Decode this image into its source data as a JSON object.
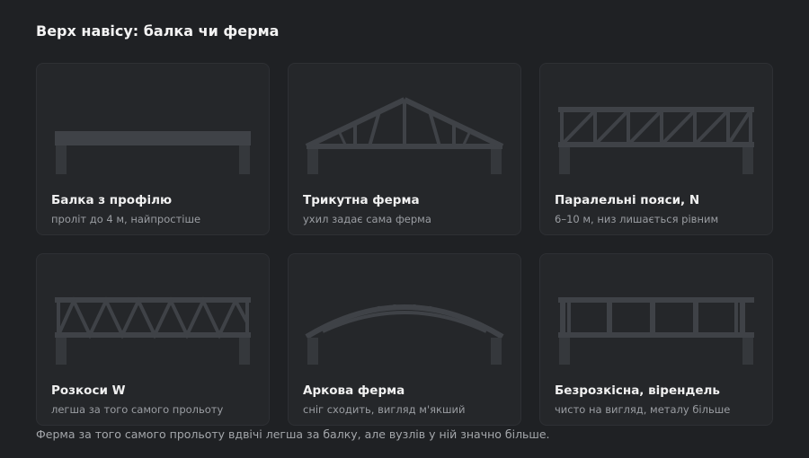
{
  "title": "Верх навісу: балка чи ферма",
  "cards": [
    {
      "title": "Балка з профілю",
      "subtitle": "проліт до 4 м, найпростіше"
    },
    {
      "title": "Трикутна ферма",
      "subtitle": "ухил задає сама ферма"
    },
    {
      "title": "Паралельні пояси, N",
      "subtitle": "6–10 м, низ лишається рівним"
    },
    {
      "title": "Розкоси W",
      "subtitle": "легша за того самого прольоту"
    },
    {
      "title": "Аркова ферма",
      "subtitle": "сніг сходить, вигляд м'якший"
    },
    {
      "title": "Безрозкісна, вірендель",
      "subtitle": "чисто на вигляд, металу більше"
    }
  ],
  "footnote": "Ферма за того самого прольоту вдвічі легша за балку, але вузлів у ній значно більше.",
  "colors": {
    "background": "#1f2124",
    "card": "#25272a",
    "steel": "#3f4247"
  },
  "icons": [
    "beam-diagram-icon",
    "triangular-truss-icon",
    "parallel-chord-n-truss-icon",
    "warren-w-truss-icon",
    "arched-truss-icon",
    "vierendeel-truss-icon"
  ]
}
